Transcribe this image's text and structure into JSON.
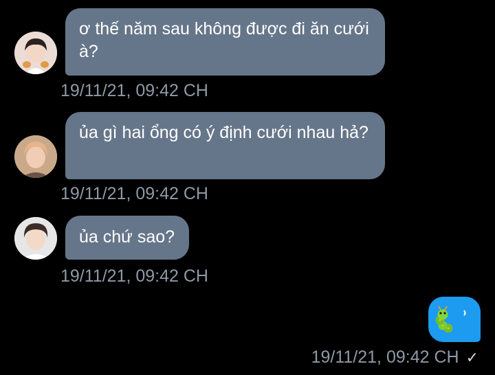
{
  "messages": [
    {
      "text": "ơ thế năm sau không được đi ăn cưới à?",
      "timestamp": "19/11/21, 09:42 CH",
      "avatar_icon": "user-avatar-1"
    },
    {
      "text": "ủa gì hai ổng có ý định cưới nhau hả?",
      "timestamp": "19/11/21, 09:42 CH",
      "avatar_icon": "user-avatar-2"
    },
    {
      "text": "ủa chứ sao?",
      "timestamp": "19/11/21, 09:42 CH",
      "avatar_icon": "user-avatar-3"
    }
  ],
  "outgoing": {
    "emoji_icon": "caterpillar-emoji",
    "timestamp": "19/11/21, 09:42 CH",
    "status_icon": "checkmark-icon",
    "status_glyph": "✓",
    "bubble_color": "#1d9bf0"
  },
  "colors": {
    "background": "#000000",
    "incoming_bubble": "#66768a",
    "timestamp": "#8e9aa8"
  }
}
